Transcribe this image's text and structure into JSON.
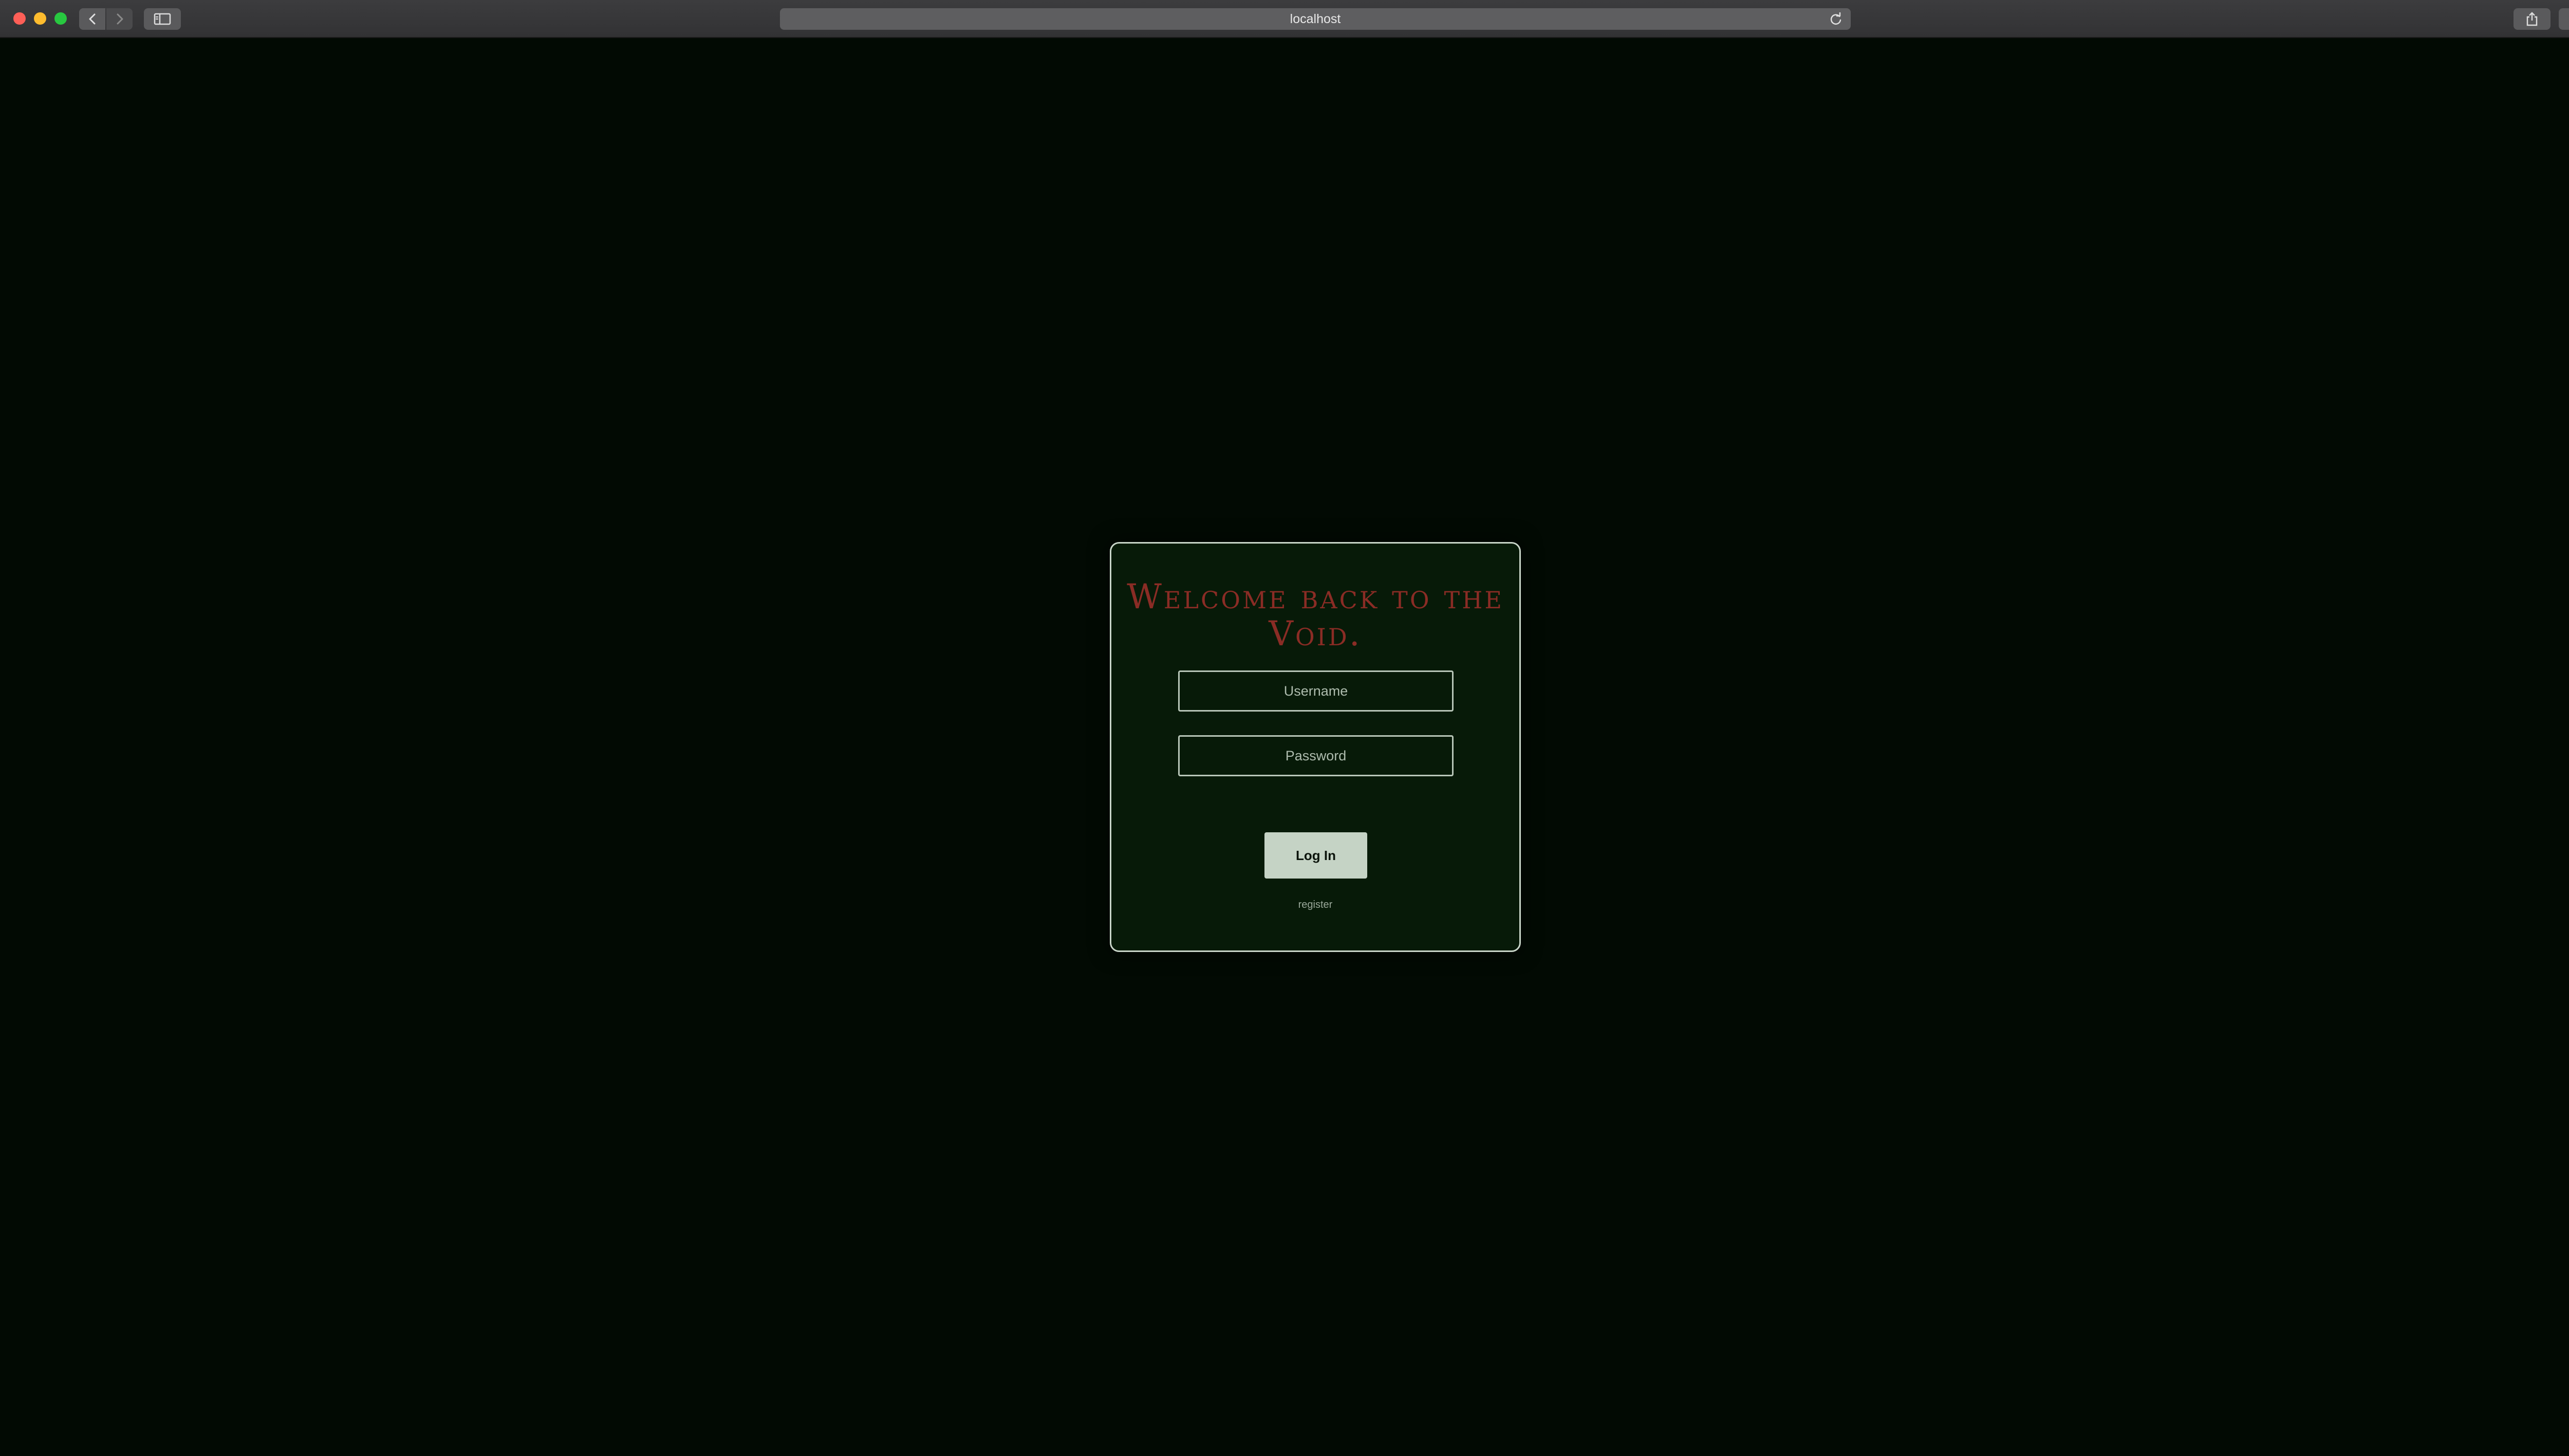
{
  "browser": {
    "address": "localhost",
    "icons": {
      "back": "chevron-left-icon",
      "forward": "chevron-right-icon",
      "sidebar": "sidebar-icon",
      "reload": "reload-icon",
      "share": "share-icon",
      "tabs": "tabs-overview-icon",
      "new_tab": "plus-icon"
    }
  },
  "login": {
    "title": "Welcome back to the Void.",
    "username_placeholder": "Username",
    "password_placeholder": "Password",
    "login_label": "Log In",
    "register_label": "register"
  },
  "colors": {
    "background": "#020a03",
    "card": "#071a08",
    "title": "#8a2c25",
    "button": "#c5d3c5"
  }
}
